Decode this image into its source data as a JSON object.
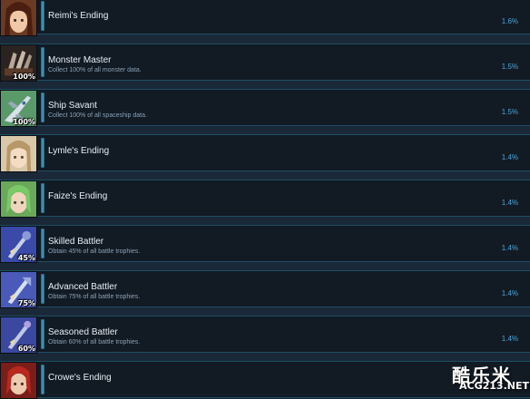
{
  "achievements": [
    {
      "title": "Reimi's Ending",
      "description": "",
      "percent": "1.6%",
      "icon": "reimi-portrait-icon",
      "badge": ""
    },
    {
      "title": "Monster Master",
      "description": "Collect 100% of all monster data.",
      "percent": "1.5%",
      "icon": "monster-claw-icon",
      "badge": "100%"
    },
    {
      "title": "Ship Savant",
      "description": "Collect 100% of all spaceship data.",
      "percent": "1.5%",
      "icon": "spaceship-icon",
      "badge": "100%"
    },
    {
      "title": "Lymle's Ending",
      "description": "",
      "percent": "1.4%",
      "icon": "lymle-portrait-icon",
      "badge": ""
    },
    {
      "title": "Faize's Ending",
      "description": "",
      "percent": "1.4%",
      "icon": "faize-portrait-icon",
      "badge": ""
    },
    {
      "title": "Skilled Battler",
      "description": "Obtain 45% of all battle trophies.",
      "percent": "1.4%",
      "icon": "trophy-weapon-icon",
      "badge": "45%"
    },
    {
      "title": "Advanced Battler",
      "description": "Obtain 75% of all battle trophies.",
      "percent": "1.4%",
      "icon": "trophy-weapon-icon",
      "badge": "75%"
    },
    {
      "title": "Seasoned Battler",
      "description": "Obtain 60% of all battle trophies.",
      "percent": "1.4%",
      "icon": "trophy-weapon-icon",
      "badge": "60%"
    },
    {
      "title": "Crowe's Ending",
      "description": "",
      "percent": "",
      "icon": "crowe-portrait-icon",
      "badge": ""
    }
  ],
  "watermark": {
    "cn": "酷乐米",
    "en": "ACG213.NET"
  },
  "colors": {
    "background": "#1b2838",
    "row": "#121a24",
    "border": "#1d4e63",
    "accent": "#4ea5d9"
  }
}
